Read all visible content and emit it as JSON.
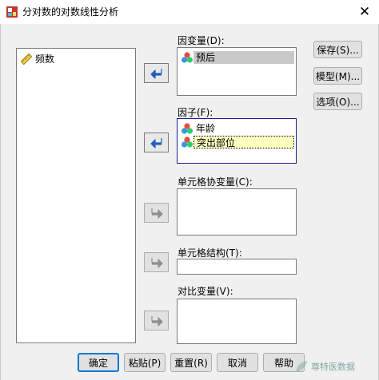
{
  "window": {
    "title": "分对数的对数线性分析",
    "close_glyph": "✕"
  },
  "variable_list": {
    "items": [
      {
        "label": "频数",
        "icon": "scale-ruler-icon"
      }
    ]
  },
  "dependent": {
    "label": "因变量(D):",
    "items": [
      {
        "label": "预后",
        "icon": "nominal-variable-icon"
      }
    ]
  },
  "factor": {
    "label": "因子(F):",
    "items": [
      {
        "label": "年龄",
        "icon": "nominal-variable-icon"
      },
      {
        "label": "突出部位",
        "icon": "nominal-variable-icon"
      }
    ]
  },
  "cell_covariate": {
    "label": "单元格协变量(C):"
  },
  "cell_structure": {
    "label": "单元格结构(T):",
    "value": ""
  },
  "contrast": {
    "label": "对比变量(V):"
  },
  "side_buttons": {
    "save": "保存(S)...",
    "model": "模型(M)...",
    "options": "选项(O)..."
  },
  "bottom_buttons": {
    "ok": "确定",
    "paste": "粘贴(P)",
    "reset": "重置(R)",
    "cancel": "取消",
    "help": "帮助"
  },
  "watermark": {
    "text": "尊特医数据"
  },
  "colors": {
    "arrow_active": "#1f5fbf",
    "arrow_inactive": "#8e8e8e",
    "default_border": "#0078d7"
  }
}
